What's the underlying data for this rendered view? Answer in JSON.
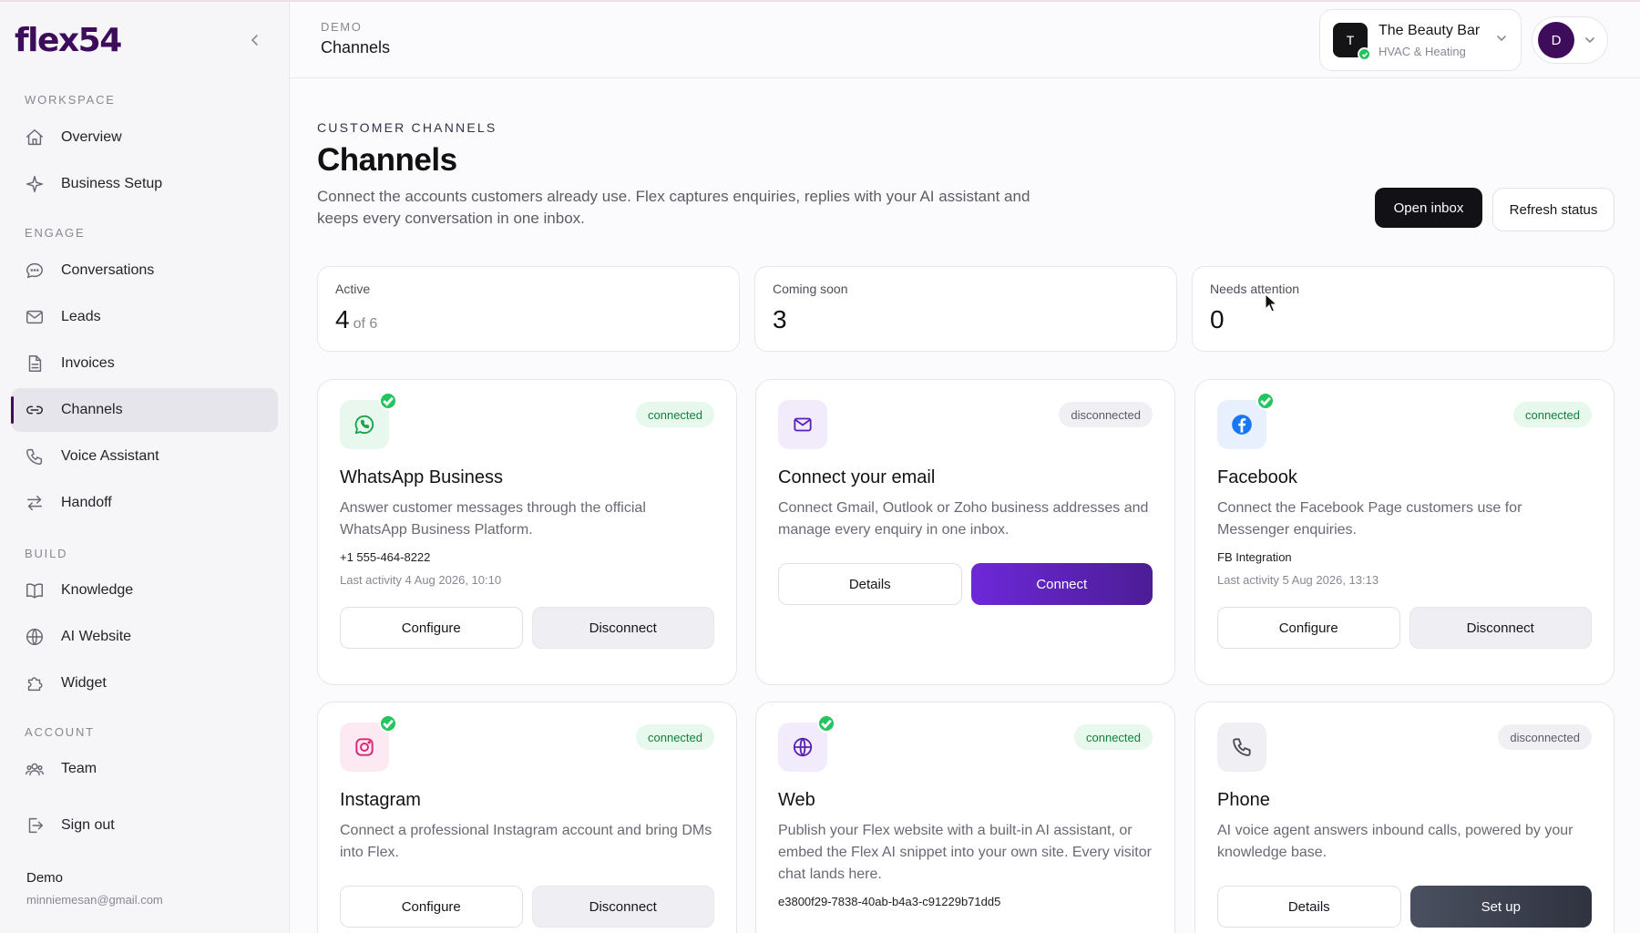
{
  "sidebar": {
    "brand": "flex54",
    "sections": {
      "workspace": "WORKSPACE",
      "engage": "ENGAGE",
      "build": "BUILD",
      "account": "ACCOUNT"
    },
    "items": {
      "overview": "Overview",
      "business_setup": "Business Setup",
      "conversations": "Conversations",
      "leads": "Leads",
      "invoices": "Invoices",
      "channels": "Channels",
      "voice_assistant": "Voice Assistant",
      "handoff": "Handoff",
      "knowledge": "Knowledge",
      "ai_website": "AI Website",
      "widget": "Widget",
      "team": "Team",
      "sign_out": "Sign out"
    },
    "active_item": "channels",
    "user": {
      "name": "Demo",
      "email": "minniemesan@gmail.com"
    }
  },
  "topbar": {
    "breadcrumb_small": "DEMO",
    "breadcrumb_title": "Channels",
    "workspace": {
      "avatar": "T",
      "name": "The Beauty Bar",
      "subtitle": "HVAC & Heating"
    },
    "profile": {
      "avatar": "D"
    }
  },
  "page": {
    "eyebrow": "CUSTOMER CHANNELS",
    "title": "Channels",
    "description": "Connect the accounts customers already use. Flex captures enquiries, replies with your AI assistant and keeps every conversation in one inbox.",
    "open_inbox": "Open inbox",
    "refresh_status": "Refresh status"
  },
  "stats": [
    {
      "label": "Active",
      "value": "4",
      "suffix": "of 6"
    },
    {
      "label": "Coming soon",
      "value": "3"
    },
    {
      "label": "Needs attention",
      "value": "0"
    }
  ],
  "channels": {
    "whatsapp": {
      "title": "WhatsApp Business",
      "status": "connected",
      "description": "Answer customer messages through the official WhatsApp Business Platform.",
      "meta1": "+1 555-464-8222",
      "meta2": "Last activity 4 Aug 2026, 10:10",
      "primary": "Configure",
      "secondary": "Disconnect",
      "icon": "whatsapp-icon"
    },
    "email": {
      "title": "Connect your email",
      "status": "disconnected",
      "description": "Connect Gmail, Outlook or Zoho business addresses and manage every enquiry in one inbox.",
      "primary": "Details",
      "secondary": "Connect",
      "icon": "mail-icon"
    },
    "facebook": {
      "title": "Facebook",
      "status": "connected",
      "description": "Connect the Facebook Page customers use for Messenger enquiries.",
      "meta1": "FB Integration",
      "meta2": "Last activity 5 Aug 2026, 13:13",
      "primary": "Configure",
      "secondary": "Disconnect",
      "icon": "facebook-icon"
    },
    "instagram": {
      "title": "Instagram",
      "status": "connected",
      "description": "Connect a professional Instagram account and bring DMs into Flex.",
      "primary": "Configure",
      "secondary": "Disconnect",
      "icon": "instagram-icon"
    },
    "web": {
      "title": "Web",
      "status": "connected",
      "description": "Publish your Flex website with a built-in AI assistant, or embed the Flex AI snippet into your own site. Every visitor chat lands here.",
      "meta1": "e3800f29-7838-40ab-b4a3-c91229b71dd5",
      "icon": "globe-icon"
    },
    "phone": {
      "title": "Phone",
      "status": "disconnected",
      "description": "AI voice agent answers inbound calls, powered by your knowledge base.",
      "primary": "Details",
      "secondary": "Set up",
      "icon": "phone-icon"
    }
  },
  "colors": {
    "brand": "#3d0d5c",
    "connected": "#15803d",
    "connect_button": "#6d28d9"
  }
}
